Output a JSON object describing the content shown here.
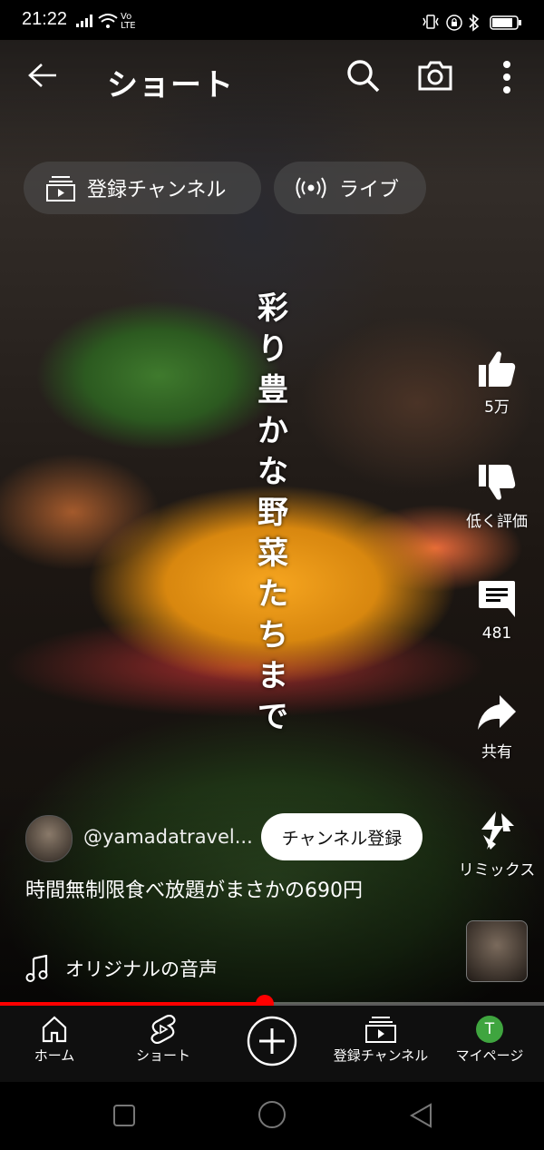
{
  "status_bar": {
    "time": "21:22",
    "network_label": "Vo LTE"
  },
  "header": {
    "title": "ショート",
    "back_icon": "back-arrow-icon",
    "search_icon": "search-icon",
    "camera_icon": "camera-icon",
    "more_icon": "more-vert-icon"
  },
  "pills": {
    "subscriptions_label": "登録チャンネル",
    "live_label": "ライブ"
  },
  "caption": [
    "彩",
    "り",
    "豊",
    "か",
    "な",
    "野",
    "菜",
    "た",
    "ち",
    "ま",
    "で"
  ],
  "actions": {
    "like_count": "5万",
    "dislike_label": "低く評価",
    "comment_count": "481",
    "share_label": "共有",
    "remix_label": "リミックス"
  },
  "video": {
    "channel_handle": "@yamadatravel...",
    "subscribe_label": "チャンネル登録",
    "title": "時間無制限食べ放題がまさかの690円",
    "sound_label": "オリジナルの音声",
    "progress": 0.487
  },
  "bottom_nav": {
    "items": [
      {
        "label": "ホーム",
        "icon": "home-icon"
      },
      {
        "label": "ショート",
        "icon": "shorts-icon"
      },
      {
        "label": "",
        "icon": "create-plus-icon"
      },
      {
        "label": "登録チャンネル",
        "icon": "subscriptions-icon"
      },
      {
        "label": "マイページ",
        "icon": "profile-avatar-icon",
        "avatar_letter": "T",
        "avatar_color": "#3fa53f"
      }
    ]
  },
  "colors": {
    "accent_red": "#ff0000",
    "nav_background": "#0f0f0f"
  }
}
